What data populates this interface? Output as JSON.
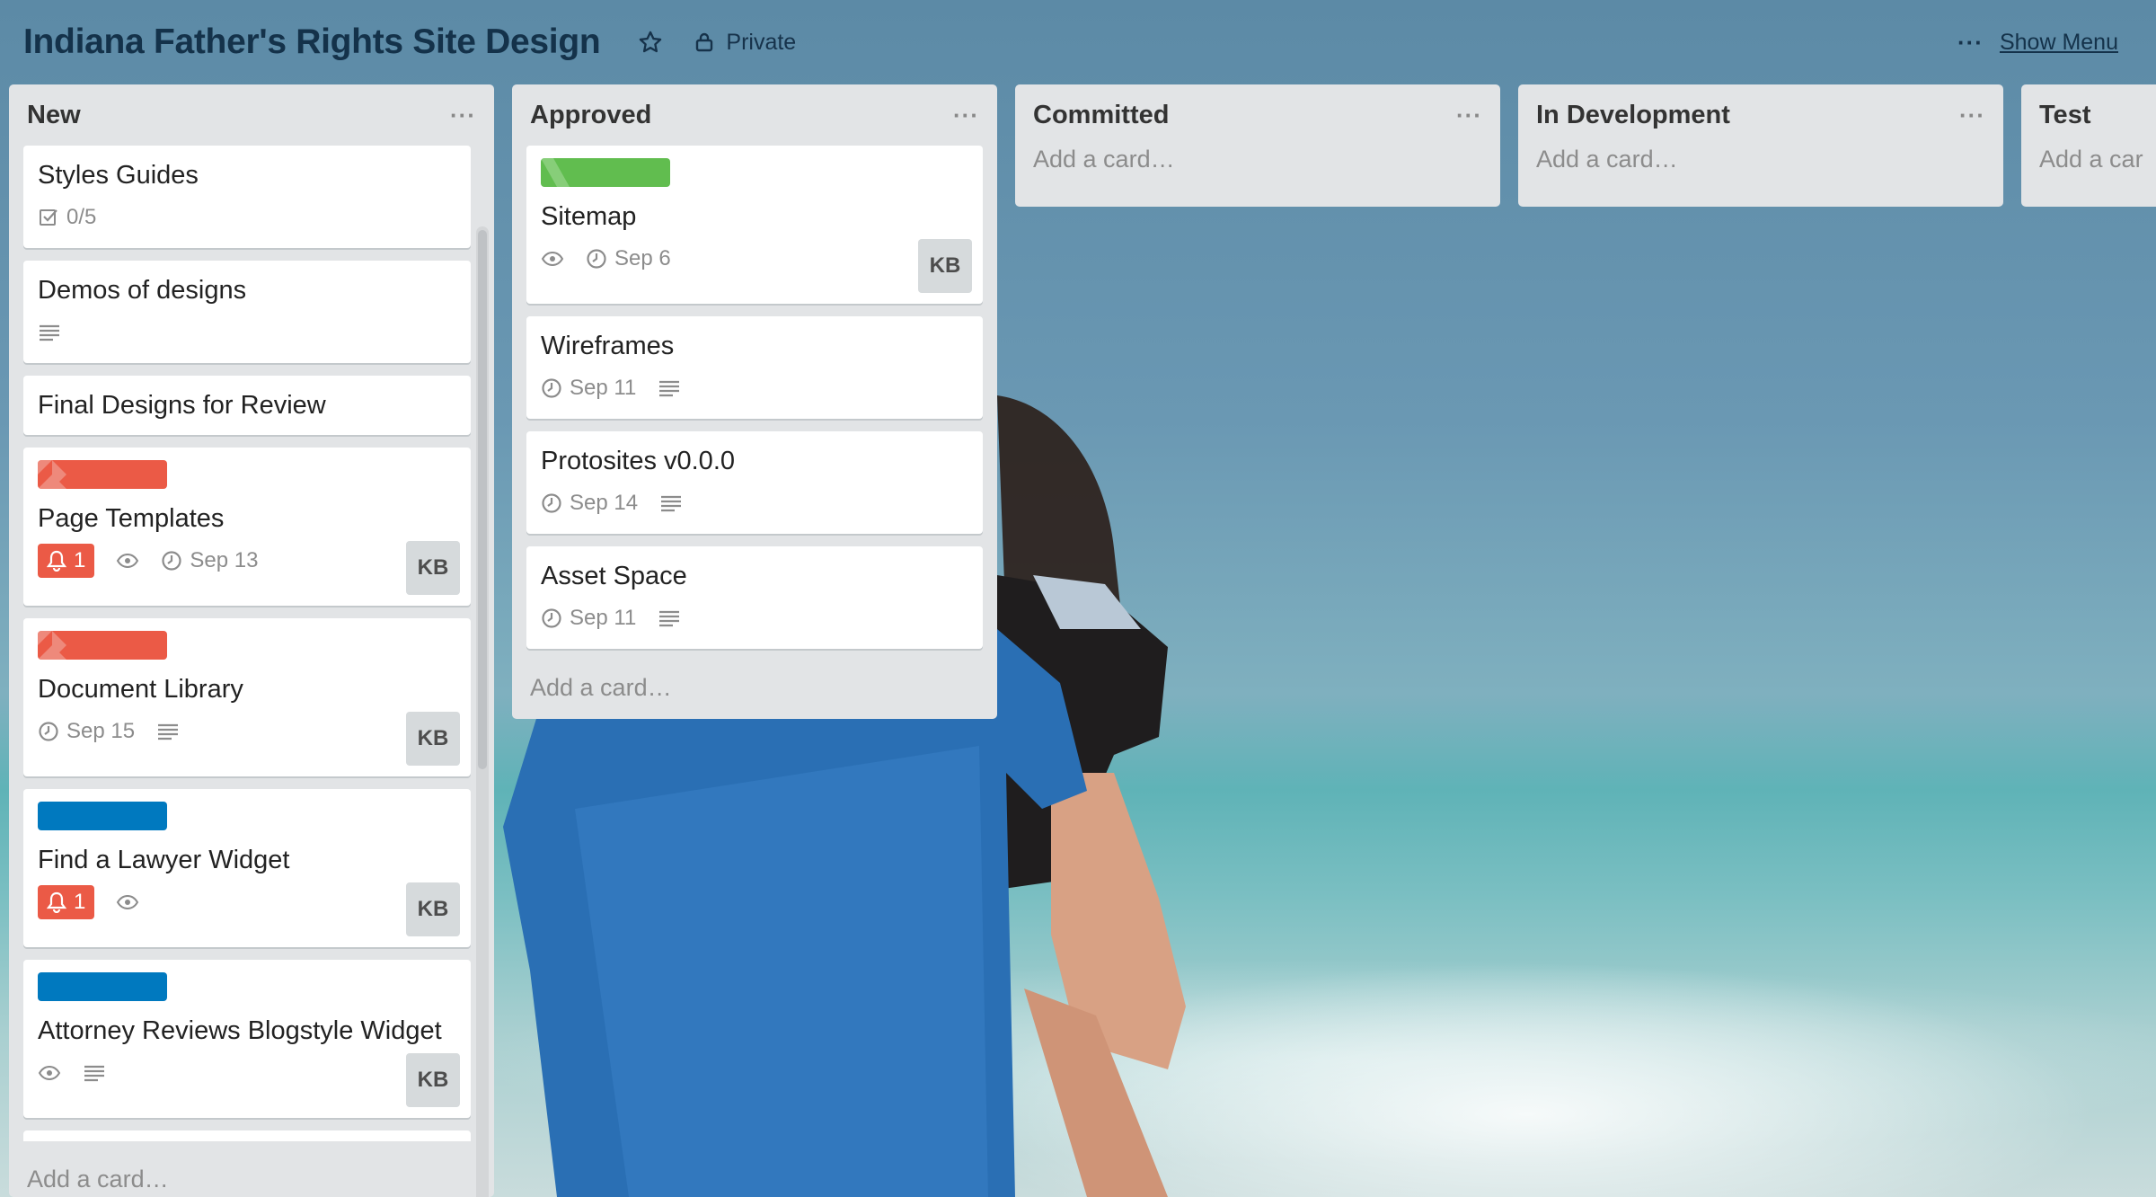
{
  "board": {
    "title": "Indiana Father's Rights Site Design",
    "visibility": "Private",
    "menu_dots": "···",
    "show_menu": "Show Menu"
  },
  "colors": {
    "red_label": "#eb5a46",
    "green_label": "#61bd4f",
    "blue_label": "#0079bf",
    "yellow_label": "#f2d600"
  },
  "lists": [
    {
      "title": "New",
      "menu": "···",
      "add_card": "Add a card…",
      "cards": [
        {
          "title": "Styles Guides",
          "checklist": "0/5"
        },
        {
          "title": "Demos of designs"
        },
        {
          "title": "Final Designs for Review"
        },
        {
          "title": "Page Templates",
          "notifications": "1",
          "due": "Sep 13",
          "member": "KB"
        },
        {
          "title": "Document Library",
          "due": "Sep 15",
          "member": "KB"
        },
        {
          "title": "Find a Lawyer Widget",
          "notifications": "1",
          "member": "KB"
        },
        {
          "title": "Attorney Reviews Blogstyle Widget",
          "member": "KB"
        }
      ]
    },
    {
      "title": "Approved",
      "menu": "···",
      "add_card": "Add a card…",
      "cards": [
        {
          "title": "Sitemap",
          "due": "Sep 6",
          "member": "KB"
        },
        {
          "title": "Wireframes",
          "due": "Sep 11"
        },
        {
          "title": "Protosites v0.0.0",
          "due": "Sep 14"
        },
        {
          "title": "Asset Space",
          "due": "Sep 11"
        }
      ]
    },
    {
      "title": "Committed",
      "menu": "···",
      "add_card": "Add a card…"
    },
    {
      "title": "In Development",
      "menu": "···",
      "add_card": "Add a card…"
    },
    {
      "title": "Test",
      "add_card": "Add a car"
    }
  ]
}
